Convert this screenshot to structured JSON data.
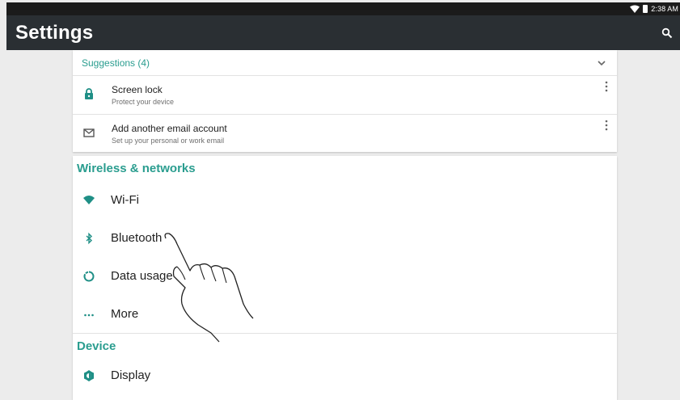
{
  "status_bar": {
    "time": "2:38 AM",
    "icons": [
      "wifi-icon",
      "battery-icon"
    ]
  },
  "app_bar": {
    "title": "Settings",
    "icons": [
      "search-icon"
    ]
  },
  "suggestions": {
    "title": "Suggestions (4)",
    "items": [
      {
        "title": "Screen lock",
        "subtitle": "Protect your device",
        "icon": "lock-icon"
      },
      {
        "title": "Add another email account",
        "subtitle": "Set up your personal or work email",
        "icon": "email-icon"
      }
    ]
  },
  "sections": [
    {
      "title": "Wireless & networks",
      "items": [
        {
          "label": "Wi‑Fi",
          "icon": "wifi-icon"
        },
        {
          "label": "Bluetooth",
          "icon": "bluetooth-icon"
        },
        {
          "label": "Data usage",
          "icon": "data-usage-icon"
        },
        {
          "label": "More",
          "icon": "more-horiz-icon"
        }
      ]
    },
    {
      "title": "Device",
      "items": [
        {
          "label": "Display",
          "icon": "display-brightness-icon"
        }
      ]
    }
  ],
  "colors": {
    "accent": "#2a9d8f",
    "app_bar": "#2a2f33",
    "status_bar": "#1b1b1b",
    "background": "#ececec"
  }
}
